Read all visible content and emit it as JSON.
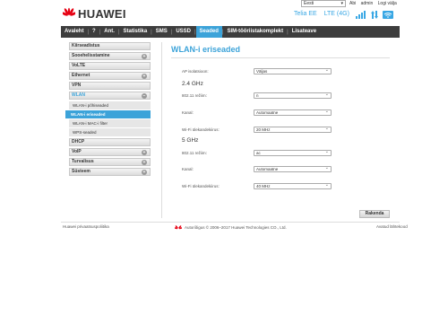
{
  "header": {
    "brand": "HUAWEI",
    "language": "Eesti",
    "links": [
      "Abi",
      "admin",
      "Logi välja"
    ],
    "operator": "Telia EE",
    "network": "LTE (4G)"
  },
  "nav": {
    "items": [
      "Avaleht",
      "?",
      "Ant.",
      "Statistika",
      "SMS",
      "USSD",
      "Seaded",
      "SIM-tööriistakomplekt",
      "Lisateave"
    ],
    "active": "Seaded"
  },
  "sidebar": {
    "items": [
      {
        "label": "Kiirseadistus",
        "expandable": false
      },
      {
        "label": "Sooeheliss­tamine",
        "expandable": true
      },
      {
        "label": "VoLTE",
        "expandable": false
      },
      {
        "label": "Ethernet",
        "expandable": true
      },
      {
        "label": "VPN",
        "expandable": false
      },
      {
        "label": "WLAN",
        "expandable": true
      }
    ],
    "wlan_sub": [
      "WLAN-i põhiseaded",
      "WLAN-i eriseaded",
      "WLAN-i MAC-i filter",
      "WPS-seaded"
    ],
    "items_after": [
      {
        "label": "DHCP",
        "expandable": false
      },
      {
        "label": "VoIP",
        "expandable": true
      },
      {
        "label": "Turvalisus",
        "expandable": true
      },
      {
        "label": "Süsteem",
        "expandable": true
      }
    ]
  },
  "content": {
    "title": "WLAN-i eriseaded",
    "ap_isolation_label": "AP isolatsioon:",
    "ap_isolation_value": "Väljas",
    "section_24": "2.4 GHz",
    "section_5": "5 GHz",
    "mode_label": "802.11 režiim:",
    "mode_24_value": "n",
    "mode_5_value": "ac",
    "channel_label": "Kanal:",
    "channel_24_value": "Automaatne",
    "channel_5_value": "Automaatne",
    "bandwidth_label": "Wi-Fi ülekandekiirus:",
    "bandwidth_24_value": "20 MHz",
    "bandwidth_5_value": "40 MHz",
    "apply_button": "Rakenda"
  },
  "footer": {
    "left": "Huawei privaatsuspoliitika",
    "middle": "Autoriõigus © 2006–2017 Huawei Technologies CO., Ltd.",
    "right": "Avatud lähtekood"
  },
  "colors": {
    "accent": "#3ca3d9",
    "nav_bg": "#3d3d3d",
    "brand_red": "#e60012"
  }
}
